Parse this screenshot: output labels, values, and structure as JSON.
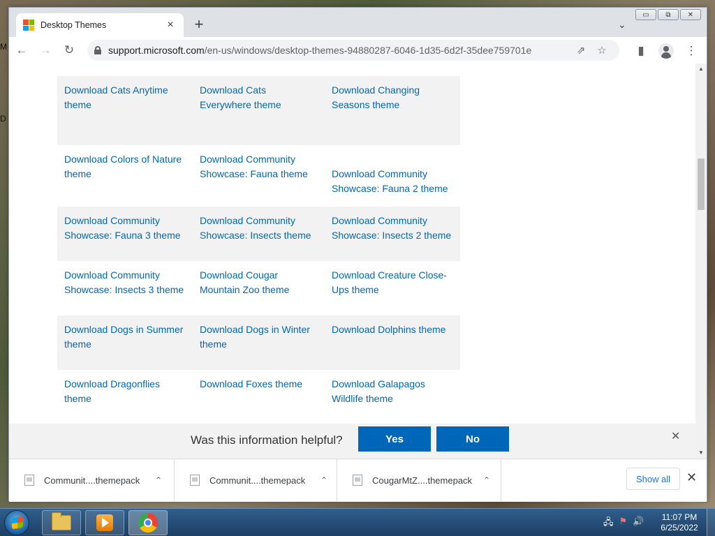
{
  "desktop": {
    "edge_letters": [
      "M",
      "D"
    ]
  },
  "browser": {
    "tab": {
      "title": "Desktop Themes",
      "close_icon": "×"
    },
    "new_tab_icon": "+",
    "tab_search_icon": "⌄",
    "window_controls": {
      "minimize": "▭",
      "restore": "⧉",
      "close": "✕"
    },
    "toolbar": {
      "back_icon": "←",
      "forward_icon": "→",
      "reload_icon": "↻",
      "url_host": "support.microsoft.com",
      "url_path": "/en-us/windows/desktop-themes-94880287-6046-1d35-6d2f-35dee759701e",
      "share_icon": "⇗",
      "star_icon": "☆",
      "side_panel_icon": "▮",
      "menu_icon": "⋮"
    }
  },
  "themes": {
    "rows": [
      {
        "shaded": true,
        "cells": [
          "Download Cats Anytime theme",
          "Download Cats Everywhere theme",
          "Download Changing Seasons theme"
        ]
      },
      {
        "shaded": false,
        "cells": [
          "Download Colors of Nature theme",
          "Download Community Showcase: Fauna theme",
          "Download Community Showcase: Fauna 2 theme"
        ]
      },
      {
        "shaded": true,
        "cells": [
          "Download Community Showcase: Fauna 3 theme",
          "Download Community Showcase: Insects theme",
          "Download Community Showcase: Insects 2 theme"
        ]
      },
      {
        "shaded": false,
        "cells": [
          "Download Community Showcase: Insects 3 theme",
          "Download Cougar Mountain Zoo theme",
          "Download Creature Close-Ups theme"
        ]
      },
      {
        "shaded": true,
        "cells": [
          "Download Dogs in Summer theme",
          "Download Dogs in Winter theme",
          "Download Dolphins theme"
        ]
      },
      {
        "shaded": false,
        "cells": [
          "Download Dragonflies theme",
          "Download Foxes theme",
          "Download Galapagos Wildlife theme"
        ]
      }
    ]
  },
  "feedback": {
    "question": "Was this information helpful?",
    "yes_label": "Yes",
    "no_label": "No",
    "close_icon": "✕"
  },
  "downloads": {
    "items": [
      {
        "name": "Communit....themepack",
        "caret": "⌃"
      },
      {
        "name": "Communit....themepack",
        "caret": "⌃"
      },
      {
        "name": "CougarMtZ....themepack",
        "caret": "⌃"
      }
    ],
    "show_all_label": "Show all",
    "close_icon": "✕"
  },
  "taskbar": {
    "apps": [
      "file-explorer",
      "windows-media-player",
      "google-chrome"
    ],
    "tray_icons": [
      "network-icon",
      "flag-icon",
      "volume-icon"
    ],
    "time": "11:07 PM",
    "date": "6/25/2022"
  },
  "colors": {
    "link": "#0067b8",
    "button": "#0067b8",
    "row_shade": "#f2f2f2",
    "taskbar": "#2a5480"
  }
}
